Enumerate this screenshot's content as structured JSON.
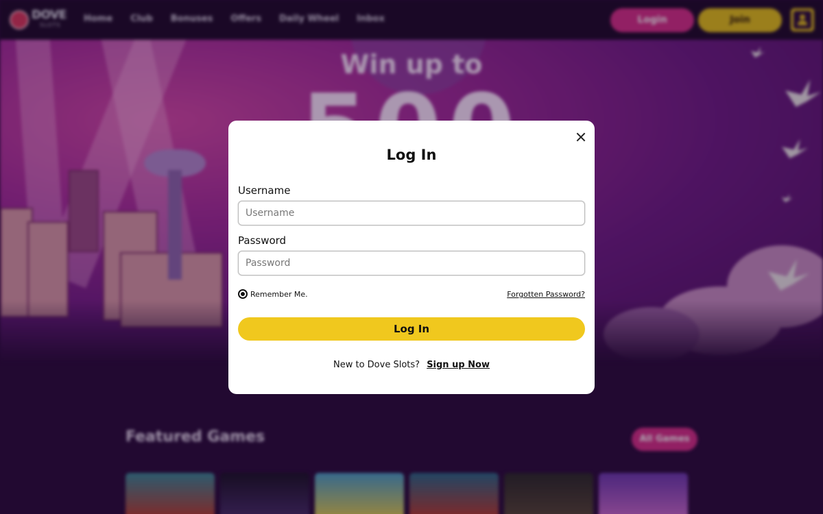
{
  "nav": {
    "logo": {
      "title": "DOVE",
      "subtitle": "SLOTS"
    },
    "links": [
      "Home",
      "Club",
      "Bonuses",
      "Offers",
      "Daily Wheel",
      "Inbox"
    ],
    "login_label": "Login",
    "join_label": "Join",
    "account_icon": "user-icon"
  },
  "hero": {
    "headline": "Win up to",
    "amount": "500"
  },
  "featured": {
    "title": "Featured Games",
    "all_games_label": "All Games"
  },
  "login_modal": {
    "title": "Log In",
    "username_label": "Username",
    "username_placeholder": "Username",
    "username_value": "",
    "password_label": "Password",
    "password_placeholder": "Password",
    "password_value": "",
    "remember_label": "Remember Me.",
    "remember_checked": true,
    "forgot_label": "Forgotten Password?",
    "submit_label": "Log In",
    "signup_prompt": "New to Dove Slots?",
    "signup_link": "Sign up Now",
    "close_icon": "close-icon"
  },
  "colors": {
    "accent_pink": "#d6308a",
    "accent_yellow": "#f0c81e",
    "background": "#2a0d3d"
  }
}
